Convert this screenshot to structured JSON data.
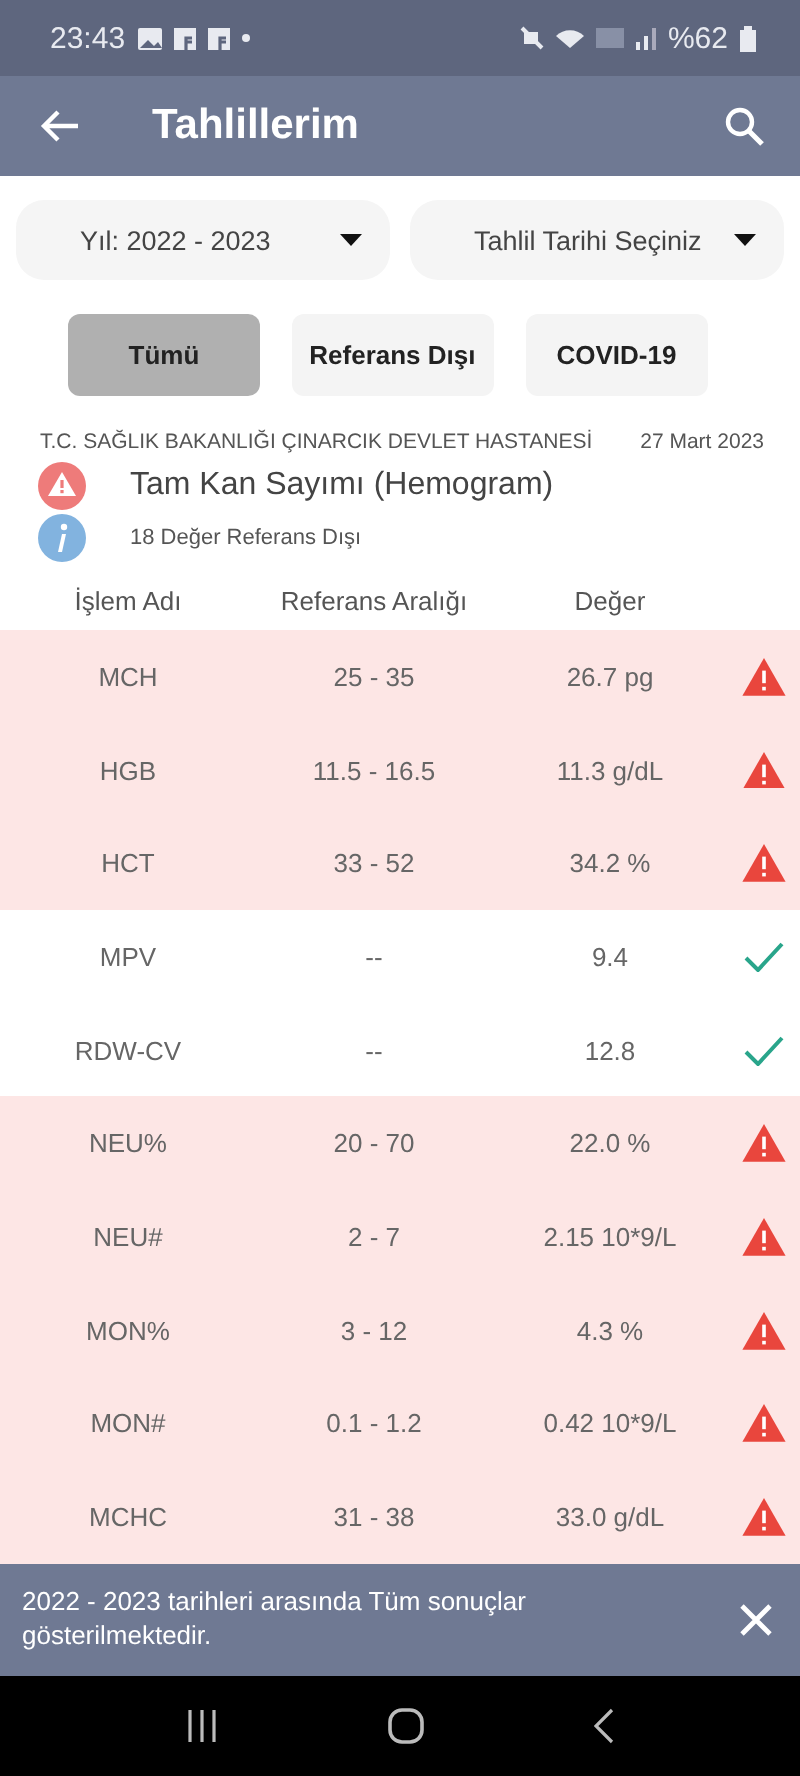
{
  "status_bar": {
    "time": "23:43",
    "battery": "%62"
  },
  "app_bar": {
    "title": "Tahlillerim"
  },
  "dropdowns": [
    {
      "value": "Yıl: 2022 - 2023"
    },
    {
      "value": "Tahlil Tarihi Seçiniz"
    }
  ],
  "filters": [
    {
      "label": "Tümü",
      "selected": true
    },
    {
      "label": "Referans Dışı",
      "selected": false
    },
    {
      "label": "COVID-19",
      "selected": false
    }
  ],
  "report": {
    "hospital": "T.C. SAĞLIK BAKANLIĞI ÇINARCIK DEVLET HASTANESİ",
    "date": "27 Mart 2023",
    "title": "Tam Kan Sayımı (Hemogram)",
    "summary": "18 Değer Referans Dışı"
  },
  "table": {
    "columns": [
      "İşlem Adı",
      "Referans Aralığı",
      "Değer"
    ],
    "rows": [
      {
        "name": "MCH",
        "range": "25 - 35",
        "value": "26.7 pg",
        "out_of_range": true
      },
      {
        "name": "HGB",
        "range": "11.5 - 16.5",
        "value": "11.3 g/dL",
        "out_of_range": true
      },
      {
        "name": "HCT",
        "range": "33 - 52",
        "value": "34.2 %",
        "out_of_range": true
      },
      {
        "name": "MPV",
        "range": "--",
        "value": "9.4",
        "out_of_range": false
      },
      {
        "name": "RDW-CV",
        "range": "--",
        "value": "12.8",
        "out_of_range": false
      },
      {
        "name": "NEU%",
        "range": "20 - 70",
        "value": "22.0 %",
        "out_of_range": true
      },
      {
        "name": "NEU#",
        "range": "2 - 7",
        "value": "2.15 10*9/L",
        "out_of_range": true
      },
      {
        "name": "MON%",
        "range": "3 - 12",
        "value": "4.3 %",
        "out_of_range": true
      },
      {
        "name": "MON#",
        "range": "0.1 - 1.2",
        "value": "0.42 10*9/L",
        "out_of_range": true
      },
      {
        "name": "MCHC",
        "range": "31 - 38",
        "value": "33.0 g/dL",
        "out_of_range": true
      }
    ]
  },
  "snackbar": {
    "message": "2022 - 2023 tarihleri arasında Tüm sonuçlar gösterilmektedir."
  }
}
